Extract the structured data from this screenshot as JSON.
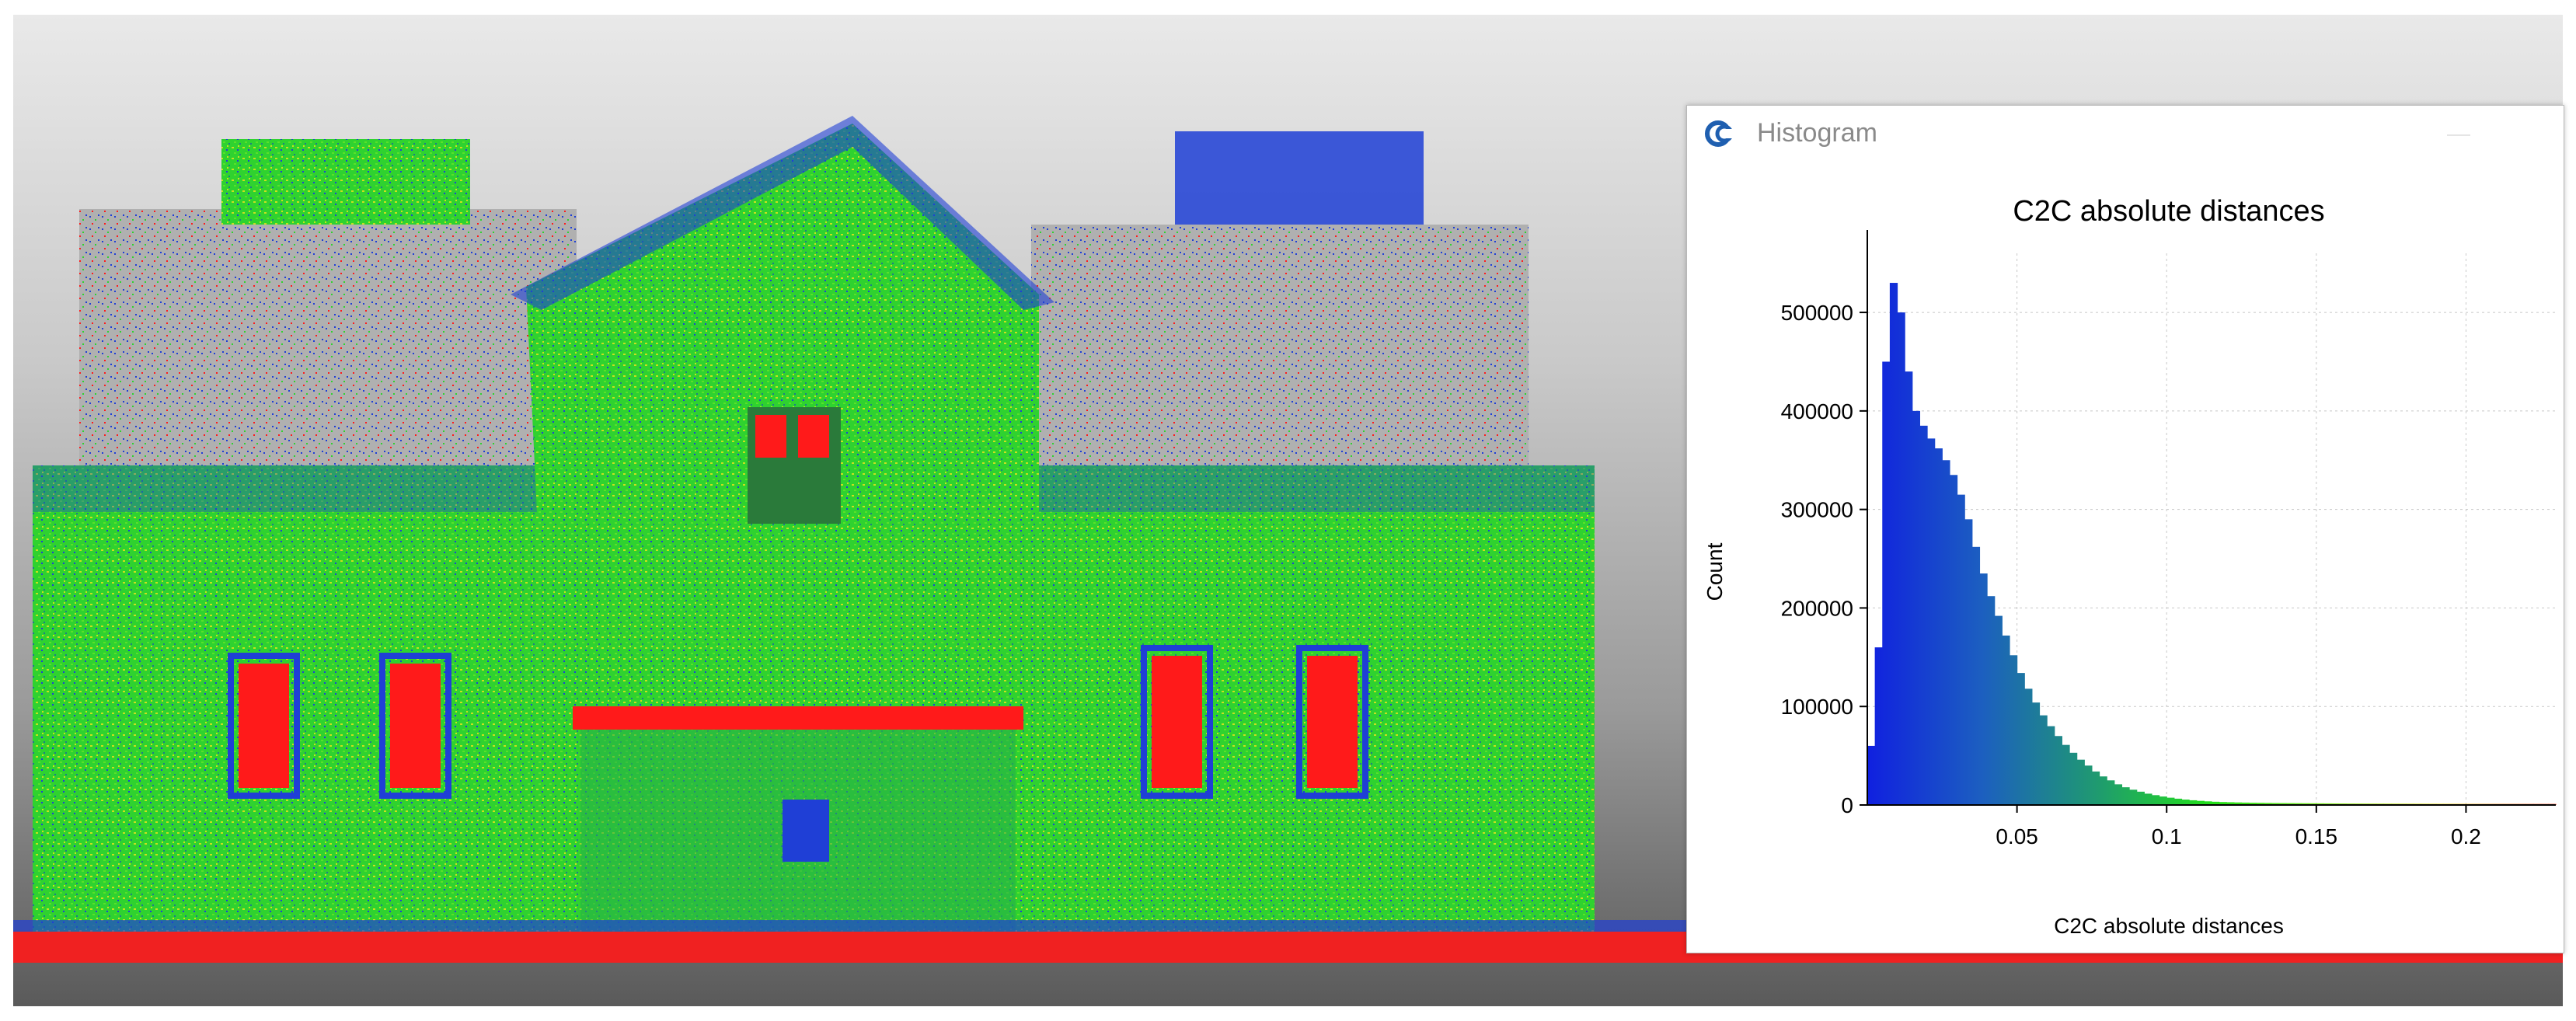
{
  "viewport": {
    "colors": {
      "scalar_low": "#1f3fd6",
      "scalar_mid": "#2fd22f",
      "scalar_high": "#ff1a1a",
      "scalar_upper_mid": "#c8e020"
    }
  },
  "histogram_window": {
    "title": "Histogram",
    "icon": "cloudcompare-logo-icon"
  },
  "chart_data": {
    "type": "bar",
    "title": "C2C absolute distances",
    "xlabel": "C2C absolute distances",
    "ylabel": "Count",
    "xlim": [
      0,
      0.23
    ],
    "ylim": [
      0,
      560000
    ],
    "x_ticks": [
      0.05,
      0.1,
      0.15,
      0.2
    ],
    "x_tick_labels": [
      "0.05",
      "0.1",
      "0.15",
      "0.2"
    ],
    "y_ticks": [
      0,
      100000,
      200000,
      300000,
      400000,
      500000
    ],
    "y_tick_labels": [
      "0",
      "100000",
      "200000",
      "300000",
      "400000",
      "500000"
    ],
    "grid": true,
    "bin_width": 0.0025,
    "x": [
      0.00125,
      0.00375,
      0.00625,
      0.00875,
      0.01125,
      0.01375,
      0.01625,
      0.01875,
      0.02125,
      0.02375,
      0.02625,
      0.02875,
      0.03125,
      0.03375,
      0.03625,
      0.03875,
      0.04125,
      0.04375,
      0.04625,
      0.04875,
      0.05125,
      0.05375,
      0.05625,
      0.05875,
      0.06125,
      0.06375,
      0.06625,
      0.06875,
      0.07125,
      0.07375,
      0.07625,
      0.07875,
      0.08125,
      0.08375,
      0.08625,
      0.08875,
      0.09125,
      0.09375,
      0.09625,
      0.09875,
      0.10125,
      0.10375,
      0.10625,
      0.10875,
      0.11125,
      0.11375,
      0.11625,
      0.11875,
      0.12125,
      0.12375,
      0.12625,
      0.12875,
      0.13125,
      0.13375,
      0.13625,
      0.13875,
      0.14125,
      0.14375,
      0.14625,
      0.14875,
      0.15125,
      0.15375,
      0.15625,
      0.15875,
      0.16125,
      0.16375,
      0.16625,
      0.16875,
      0.17125,
      0.17375,
      0.17625,
      0.17875,
      0.18125,
      0.18375,
      0.18625,
      0.18875,
      0.19125,
      0.19375,
      0.19625,
      0.19875,
      0.20125,
      0.20375,
      0.20625,
      0.20875,
      0.21125,
      0.21375,
      0.21625,
      0.21875,
      0.22125,
      0.22375,
      0.22625,
      0.22875
    ],
    "values": [
      60000,
      160000,
      450000,
      530000,
      500000,
      440000,
      400000,
      385000,
      372000,
      362000,
      350000,
      335000,
      315000,
      290000,
      262000,
      235000,
      212000,
      192000,
      172000,
      152000,
      134000,
      118000,
      104000,
      91000,
      80000,
      70000,
      61000,
      53000,
      46000,
      40000,
      34000,
      29000,
      25000,
      21000,
      18000,
      15500,
      13500,
      11500,
      10000,
      8600,
      7400,
      6400,
      5500,
      4800,
      4200,
      3700,
      3300,
      3000,
      2800,
      2600,
      2450,
      2300,
      2200,
      2100,
      2000,
      1950,
      1900,
      1850,
      1800,
      1750,
      1700,
      1650,
      1600,
      1550,
      1500,
      1480,
      1460,
      1440,
      1420,
      1400,
      1380,
      1360,
      1340,
      1320,
      1300,
      1280,
      1260,
      1240,
      1220,
      1200,
      1190,
      1180,
      1170,
      1160,
      1150,
      1140,
      1130,
      1120,
      1110,
      1100,
      1090,
      1080
    ],
    "colormap": [
      "#1020e0",
      "#1c5fc0",
      "#1f9a70",
      "#22e01a",
      "#7ae81a",
      "#f0e020",
      "#ff3a1a"
    ]
  }
}
